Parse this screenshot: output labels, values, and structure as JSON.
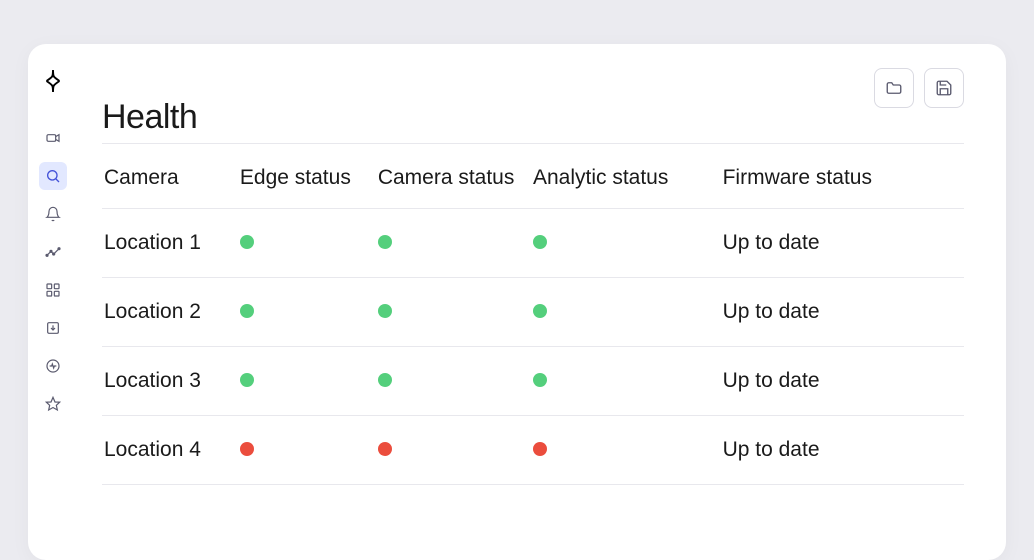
{
  "page": {
    "title": "Health"
  },
  "columns": {
    "camera": "Camera",
    "edge": "Edge status",
    "camera_status": "Camera status",
    "analytic": "Analytic status",
    "firmware": "Firmware status"
  },
  "status_colors": {
    "ok": "#54cf7c",
    "error": "#eb4d3d"
  },
  "rows": [
    {
      "camera": "Location 1",
      "edge": "ok",
      "camera_status": "ok",
      "analytic": "ok",
      "firmware": "Up to date"
    },
    {
      "camera": "Location 2",
      "edge": "ok",
      "camera_status": "ok",
      "analytic": "ok",
      "firmware": "Up to date"
    },
    {
      "camera": "Location 3",
      "edge": "ok",
      "camera_status": "ok",
      "analytic": "ok",
      "firmware": "Up to date"
    },
    {
      "camera": "Location 4",
      "edge": "error",
      "camera_status": "error",
      "analytic": "error",
      "firmware": "Up to date"
    }
  ]
}
